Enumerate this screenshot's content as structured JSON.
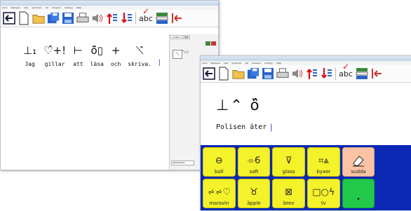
{
  "window1": {
    "menu": [
      "Arkiv",
      "Redigera",
      "Visa",
      "Symboler",
      "Val",
      "Glossarn",
      "Verktyg",
      "Hjälp"
    ],
    "panel_tabs": [
      "Lexikon",
      "Bild"
    ],
    "panel_bottom": "Adjektiv/Adverb",
    "sentence": [
      {
        "symbol": "⊥₁",
        "word": "Jag"
      },
      {
        "symbol": "♡̂+!",
        "word": "gillar"
      },
      {
        "symbol": "⊢",
        "word": "att"
      },
      {
        "symbol": "ö̂▯",
        "word": "läsa"
      },
      {
        "symbol": "+",
        "word": "och"
      },
      {
        "symbol": "⟍̂",
        "word": "skriva."
      }
    ]
  },
  "window2": {
    "menu": [
      "Arkiv",
      "Redigera",
      "Visa",
      "Symboler",
      "Val",
      "Glossarn",
      "Verktyg",
      "Hjälp"
    ],
    "symbols": "⊥⌃ ö̂",
    "text": "Polisen äter",
    "grid": [
      {
        "glyph": "⊖",
        "label": "boll",
        "color": "yellow"
      },
      {
        "glyph": "⌯6",
        "label": "saft",
        "color": "yellow"
      },
      {
        "glyph": "⊽",
        "label": "glass",
        "color": "yellow"
      },
      {
        "glyph": "⌗⩓",
        "label": "byxor",
        "color": "yellow"
      },
      {
        "glyph": "✎",
        "label": "sudda",
        "color": "pink"
      },
      {
        "glyph": "",
        "label": "",
        "color": "empty"
      },
      {
        "glyph": "⩫⩫♡",
        "label": "marsvin",
        "color": "yellow"
      },
      {
        "glyph": "♉",
        "label": "äpple",
        "color": "yellow"
      },
      {
        "glyph": "⊠",
        "label": "brev",
        "color": "yellow"
      },
      {
        "glyph": "□○ϟ",
        "label": "tv",
        "color": "yellow"
      },
      {
        "glyph": "•",
        "label": "",
        "color": "green"
      },
      {
        "glyph": "",
        "label": "",
        "color": "empty"
      }
    ]
  },
  "toolbar": {
    "abc_label": "abc"
  }
}
